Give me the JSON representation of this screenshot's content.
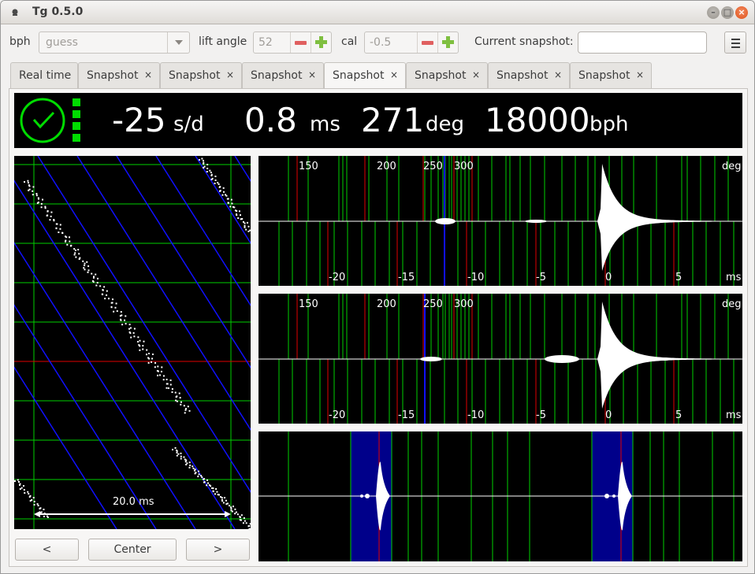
{
  "window": {
    "title": "Tg 0.5.0"
  },
  "toolbar": {
    "bph_label": "bph",
    "bph_value": "guess",
    "lift_angle_label": "lift angle",
    "lift_angle_value": "52",
    "cal_label": "cal",
    "cal_value": "-0.5",
    "snapshot_name_label": "Current snapshot:",
    "snapshot_name_value": ""
  },
  "tabs": [
    {
      "label": "Real time",
      "closable": false
    },
    {
      "label": "Snapshot",
      "closable": true
    },
    {
      "label": "Snapshot",
      "closable": true
    },
    {
      "label": "Snapshot",
      "closable": true
    },
    {
      "label": "Snapshot",
      "closable": true,
      "active": true
    },
    {
      "label": "Snapshot",
      "closable": true
    },
    {
      "label": "Snapshot",
      "closable": true
    },
    {
      "label": "Snapshot",
      "closable": true
    }
  ],
  "tab_close_glyph": "×",
  "readout": {
    "rate_value": "-25",
    "rate_unit": "s/d",
    "beat_error_value": "0.8",
    "beat_error_unit": "ms",
    "amplitude_value": "271",
    "amplitude_unit": "deg",
    "bph_value": "18000",
    "bph_unit": "bph",
    "signal_level_bars": 4,
    "status_icon": "clock-ok-icon"
  },
  "paperstrip": {
    "scale_label": "20.0 ms"
  },
  "waveforms": [
    {
      "deg_ticks": [
        "150",
        "200",
        "250",
        "300"
      ],
      "deg_unit": "deg",
      "ms_ticks": [
        "-20",
        "-15",
        "-10",
        "-5",
        "0",
        "5"
      ],
      "ms_unit": "ms"
    },
    {
      "deg_ticks": [
        "150",
        "200",
        "250",
        "300"
      ],
      "deg_unit": "deg",
      "ms_ticks": [
        "-20",
        "-15",
        "-10",
        "-5",
        "0",
        "5"
      ],
      "ms_unit": "ms"
    }
  ],
  "buttons": {
    "left": "<",
    "center": "Center",
    "right": ">"
  },
  "colors": {
    "grid_green": "#00d000",
    "grid_red": "#e00000",
    "trend_blue": "#1010ff",
    "highlight_blue": "#00008a",
    "signal": "#ffffff",
    "status_green": "#00dc00"
  }
}
